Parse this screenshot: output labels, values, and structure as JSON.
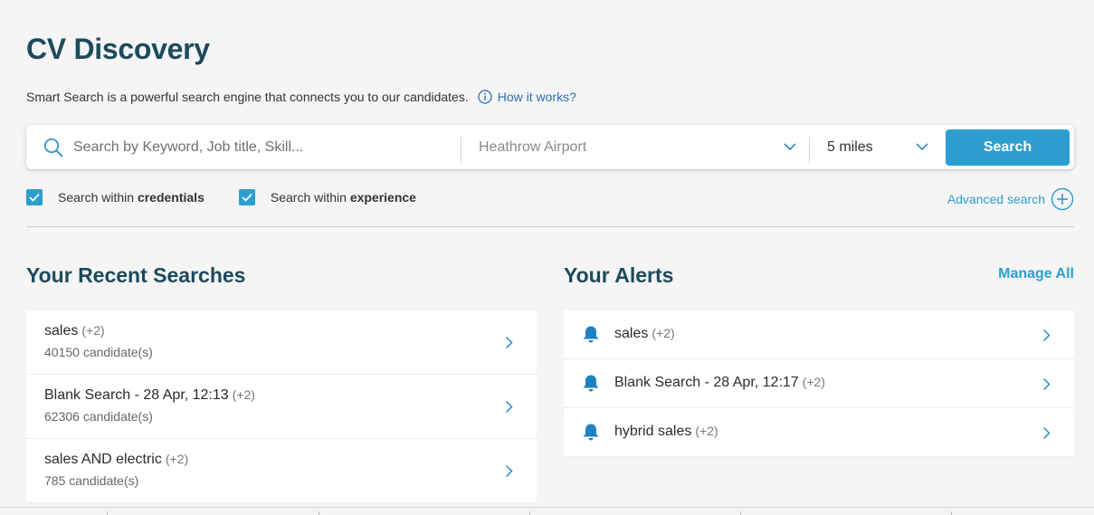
{
  "page": {
    "title": "CV Discovery",
    "intro": "Smart Search is a powerful search engine that connects you to our candidates.",
    "how_it_works": "How it works?"
  },
  "search": {
    "keyword_placeholder": "Search by Keyword, Job title, Skill...",
    "keyword_value": "",
    "location_value": "Heathrow Airport",
    "distance_value": "5 miles",
    "search_button": "Search"
  },
  "options": {
    "credentials_prefix": "Search within ",
    "credentials_bold": "credentials",
    "credentials_checked": true,
    "experience_prefix": "Search within ",
    "experience_bold": "experience",
    "experience_checked": true,
    "advanced_search": "Advanced search"
  },
  "recent": {
    "title": "Your Recent Searches",
    "items": [
      {
        "name": "sales",
        "extra": "(+2)",
        "count": "40150 candidate(s)"
      },
      {
        "name": "Blank Search - 28 Apr, 12:13",
        "extra": "(+2)",
        "count": "62306 candidate(s)"
      },
      {
        "name": "sales AND electric",
        "extra": "(+2)",
        "count": "785 candidate(s)"
      }
    ]
  },
  "alerts": {
    "title": "Your Alerts",
    "manage_all": "Manage All",
    "items": [
      {
        "name": "sales",
        "extra": "(+2)"
      },
      {
        "name": "Blank Search - 28 Apr, 12:17",
        "extra": "(+2)"
      },
      {
        "name": "hybrid sales",
        "extra": "(+2)"
      }
    ]
  },
  "icons": {
    "search": "search-icon",
    "info": "info-icon",
    "chevron_down": "chevron-down-icon",
    "checkbox": "checkmark-icon",
    "plus_circle": "plus-circle-icon",
    "chevron_right": "chevron-right-icon",
    "bell": "bell-icon"
  },
  "colors": {
    "title": "#1d4a5c",
    "accent": "#2c9fd0",
    "link": "#2a6fb6",
    "bell": "#1f7fc4",
    "background": "#f5f5f5"
  }
}
